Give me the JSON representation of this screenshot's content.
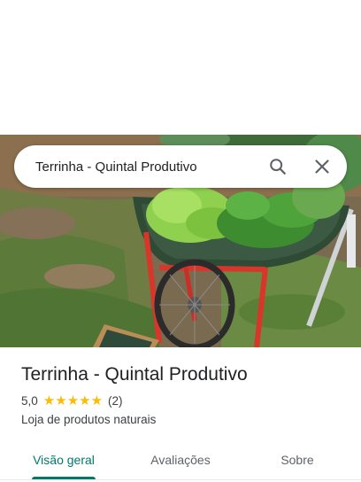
{
  "search": {
    "query": "Terrinha - Quintal Produtivo"
  },
  "place": {
    "title": "Terrinha - Quintal Produtivo",
    "rating": "5,0",
    "stars_count": 5,
    "review_count": "(2)",
    "category": "Loja de produtos naturais"
  },
  "tabs": [
    {
      "label": "Visão geral",
      "active": true
    },
    {
      "label": "Avaliações",
      "active": false
    },
    {
      "label": "Sobre",
      "active": false
    }
  ],
  "colors": {
    "accent": "#00796b",
    "star": "#fbbc04",
    "text": "#202124",
    "secondary_text": "#3c4043"
  },
  "icons": {
    "search": "search-icon",
    "close": "close-icon",
    "star": "star-icon"
  }
}
